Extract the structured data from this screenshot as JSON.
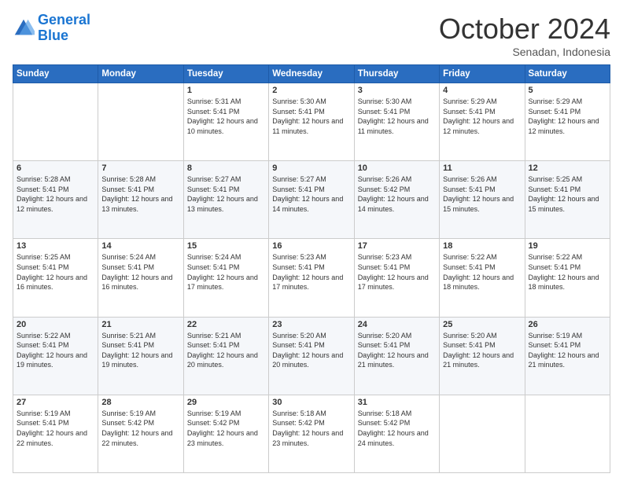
{
  "logo": {
    "text_general": "General",
    "text_blue": "Blue"
  },
  "header": {
    "month": "October 2024",
    "location": "Senadan, Indonesia"
  },
  "weekdays": [
    "Sunday",
    "Monday",
    "Tuesday",
    "Wednesday",
    "Thursday",
    "Friday",
    "Saturday"
  ],
  "weeks": [
    [
      {
        "day": "",
        "info": ""
      },
      {
        "day": "",
        "info": ""
      },
      {
        "day": "1",
        "info": "Sunrise: 5:31 AM\nSunset: 5:41 PM\nDaylight: 12 hours and 10 minutes."
      },
      {
        "day": "2",
        "info": "Sunrise: 5:30 AM\nSunset: 5:41 PM\nDaylight: 12 hours and 11 minutes."
      },
      {
        "day": "3",
        "info": "Sunrise: 5:30 AM\nSunset: 5:41 PM\nDaylight: 12 hours and 11 minutes."
      },
      {
        "day": "4",
        "info": "Sunrise: 5:29 AM\nSunset: 5:41 PM\nDaylight: 12 hours and 12 minutes."
      },
      {
        "day": "5",
        "info": "Sunrise: 5:29 AM\nSunset: 5:41 PM\nDaylight: 12 hours and 12 minutes."
      }
    ],
    [
      {
        "day": "6",
        "info": "Sunrise: 5:28 AM\nSunset: 5:41 PM\nDaylight: 12 hours and 12 minutes."
      },
      {
        "day": "7",
        "info": "Sunrise: 5:28 AM\nSunset: 5:41 PM\nDaylight: 12 hours and 13 minutes."
      },
      {
        "day": "8",
        "info": "Sunrise: 5:27 AM\nSunset: 5:41 PM\nDaylight: 12 hours and 13 minutes."
      },
      {
        "day": "9",
        "info": "Sunrise: 5:27 AM\nSunset: 5:41 PM\nDaylight: 12 hours and 14 minutes."
      },
      {
        "day": "10",
        "info": "Sunrise: 5:26 AM\nSunset: 5:42 PM\nDaylight: 12 hours and 14 minutes."
      },
      {
        "day": "11",
        "info": "Sunrise: 5:26 AM\nSunset: 5:41 PM\nDaylight: 12 hours and 15 minutes."
      },
      {
        "day": "12",
        "info": "Sunrise: 5:25 AM\nSunset: 5:41 PM\nDaylight: 12 hours and 15 minutes."
      }
    ],
    [
      {
        "day": "13",
        "info": "Sunrise: 5:25 AM\nSunset: 5:41 PM\nDaylight: 12 hours and 16 minutes."
      },
      {
        "day": "14",
        "info": "Sunrise: 5:24 AM\nSunset: 5:41 PM\nDaylight: 12 hours and 16 minutes."
      },
      {
        "day": "15",
        "info": "Sunrise: 5:24 AM\nSunset: 5:41 PM\nDaylight: 12 hours and 17 minutes."
      },
      {
        "day": "16",
        "info": "Sunrise: 5:23 AM\nSunset: 5:41 PM\nDaylight: 12 hours and 17 minutes."
      },
      {
        "day": "17",
        "info": "Sunrise: 5:23 AM\nSunset: 5:41 PM\nDaylight: 12 hours and 17 minutes."
      },
      {
        "day": "18",
        "info": "Sunrise: 5:22 AM\nSunset: 5:41 PM\nDaylight: 12 hours and 18 minutes."
      },
      {
        "day": "19",
        "info": "Sunrise: 5:22 AM\nSunset: 5:41 PM\nDaylight: 12 hours and 18 minutes."
      }
    ],
    [
      {
        "day": "20",
        "info": "Sunrise: 5:22 AM\nSunset: 5:41 PM\nDaylight: 12 hours and 19 minutes."
      },
      {
        "day": "21",
        "info": "Sunrise: 5:21 AM\nSunset: 5:41 PM\nDaylight: 12 hours and 19 minutes."
      },
      {
        "day": "22",
        "info": "Sunrise: 5:21 AM\nSunset: 5:41 PM\nDaylight: 12 hours and 20 minutes."
      },
      {
        "day": "23",
        "info": "Sunrise: 5:20 AM\nSunset: 5:41 PM\nDaylight: 12 hours and 20 minutes."
      },
      {
        "day": "24",
        "info": "Sunrise: 5:20 AM\nSunset: 5:41 PM\nDaylight: 12 hours and 21 minutes."
      },
      {
        "day": "25",
        "info": "Sunrise: 5:20 AM\nSunset: 5:41 PM\nDaylight: 12 hours and 21 minutes."
      },
      {
        "day": "26",
        "info": "Sunrise: 5:19 AM\nSunset: 5:41 PM\nDaylight: 12 hours and 21 minutes."
      }
    ],
    [
      {
        "day": "27",
        "info": "Sunrise: 5:19 AM\nSunset: 5:41 PM\nDaylight: 12 hours and 22 minutes."
      },
      {
        "day": "28",
        "info": "Sunrise: 5:19 AM\nSunset: 5:42 PM\nDaylight: 12 hours and 22 minutes."
      },
      {
        "day": "29",
        "info": "Sunrise: 5:19 AM\nSunset: 5:42 PM\nDaylight: 12 hours and 23 minutes."
      },
      {
        "day": "30",
        "info": "Sunrise: 5:18 AM\nSunset: 5:42 PM\nDaylight: 12 hours and 23 minutes."
      },
      {
        "day": "31",
        "info": "Sunrise: 5:18 AM\nSunset: 5:42 PM\nDaylight: 12 hours and 24 minutes."
      },
      {
        "day": "",
        "info": ""
      },
      {
        "day": "",
        "info": ""
      }
    ]
  ]
}
